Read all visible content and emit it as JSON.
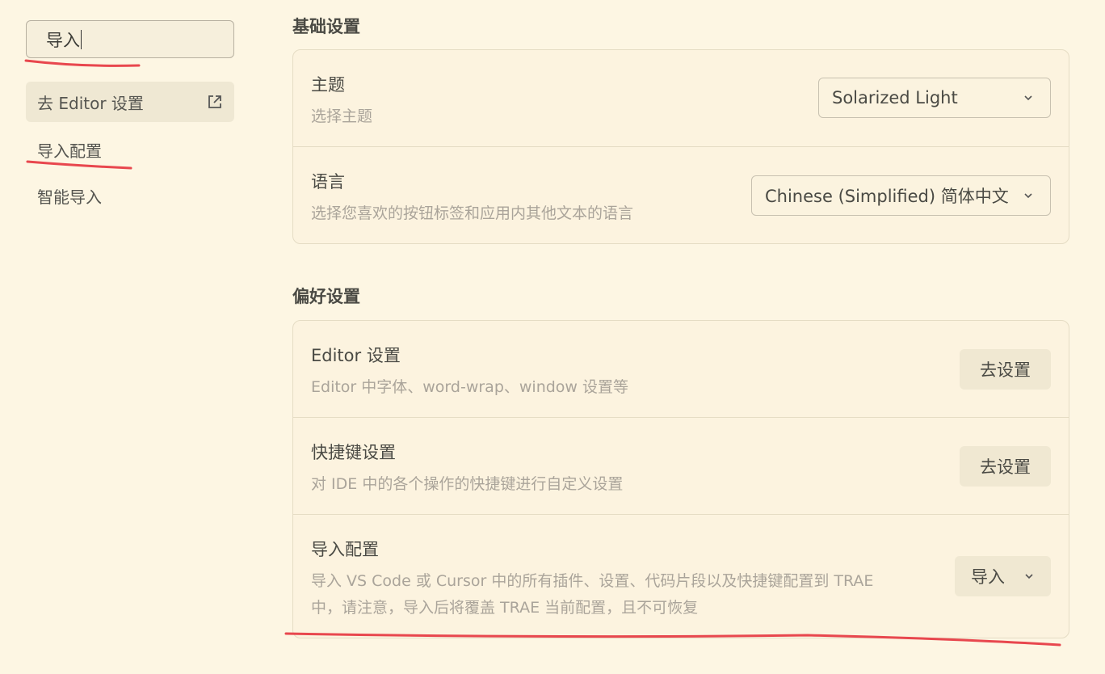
{
  "sidebar": {
    "search_value": "导入",
    "items": [
      {
        "label": "去 Editor 设置",
        "icon": "external-link-icon"
      },
      {
        "label": "导入配置"
      },
      {
        "label": "智能导入"
      }
    ]
  },
  "basic": {
    "title": "基础设置",
    "theme": {
      "title": "主题",
      "desc": "选择主题",
      "value": "Solarized Light"
    },
    "language": {
      "title": "语言",
      "desc": "选择您喜欢的按钮标签和应用内其他文本的语言",
      "value": "Chinese (Simplified) 简体中文"
    }
  },
  "prefs": {
    "title": "偏好设置",
    "editor": {
      "title": "Editor 设置",
      "desc": "Editor 中字体、word-wrap、window 设置等",
      "button": "去设置"
    },
    "shortcuts": {
      "title": "快捷键设置",
      "desc": "对 IDE 中的各个操作的快捷键进行自定义设置",
      "button": "去设置"
    },
    "import": {
      "title": "导入配置",
      "desc_line1": "导入 VS Code 或 Cursor 中的所有插件、设置、代码片段以及快捷键配置到 TRAE",
      "desc_line2": "中，请注意，导入后将覆盖 TRAE 当前配置，且不可恢复",
      "button": "导入"
    }
  },
  "colors": {
    "background": "#fdf6e3",
    "annotation": "#e8474e"
  }
}
